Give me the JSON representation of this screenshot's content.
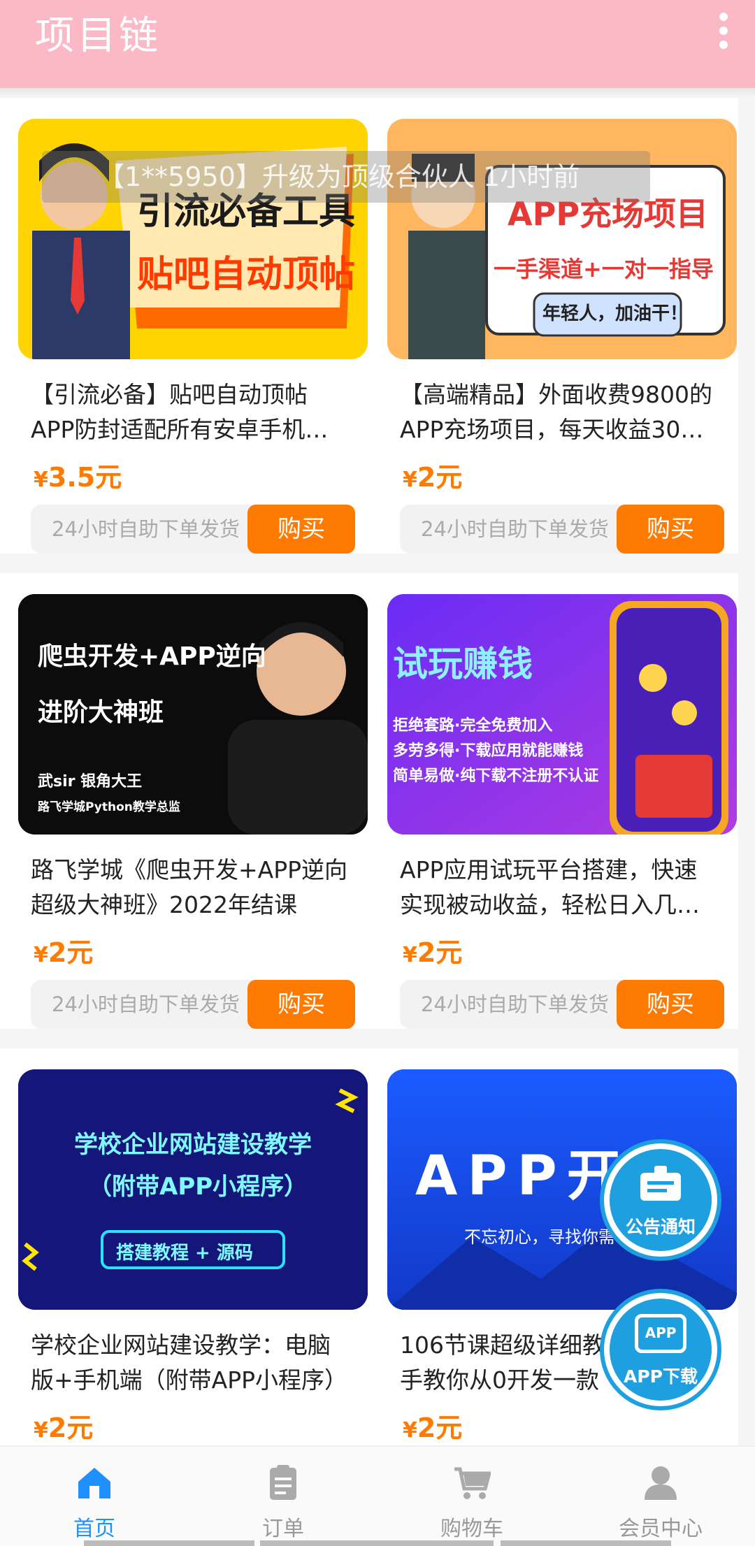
{
  "app": {
    "title": "项目链"
  },
  "ticker": "【1**5950】升级为顶级合伙人 1小时前",
  "products": [
    {
      "title_line1": "【引流必备】贴吧自动顶帖",
      "title_line2": "APP防封适配所有安卓手机…",
      "price_symbol": "¥",
      "price": "3.5元",
      "delivery": "24小时自助下单发货",
      "buy": "购买",
      "thumb": {
        "line1": "引流必备工具",
        "line2": "贴吧自动顶帖"
      }
    },
    {
      "title_line1": "【高端精品】外面收费9800的",
      "title_line2": "APP充场项目，每天收益30…",
      "price_symbol": "¥",
      "price": "2元",
      "delivery": "24小时自助下单发货",
      "buy": "购买",
      "thumb": {
        "line1": "APP充场项目",
        "line2": "一手渠道+一对一指导",
        "line3": "年轻人，加油干！"
      }
    },
    {
      "title_line1": "路飞学城《爬虫开发+APP逆向",
      "title_line2": "超级大神班》2022年结课",
      "price_symbol": "¥",
      "price": "2元",
      "delivery": "24小时自助下单发货",
      "buy": "购买",
      "thumb": {
        "line1": "爬虫开发+APP逆向",
        "line2": "进阶大神班",
        "line3": "武sir 银角大王",
        "line4": "路飞学城Python教学总监"
      }
    },
    {
      "title_line1": "APP应用试玩平台搭建，快速",
      "title_line2": "实现被动收益，轻松日入几…",
      "price_symbol": "¥",
      "price": "2元",
      "delivery": "24小时自助下单发货",
      "buy": "购买",
      "thumb": {
        "line1": "试玩赚钱",
        "line2": "拒绝套路·完全免费加入",
        "line3": "多劳多得·下载应用就能赚钱",
        "line4": "简单易做·纯下载不注册不认证"
      }
    },
    {
      "title_line1": "学校企业网站建设教学：电脑",
      "title_line2": "版+手机端（附带APP小程序）",
      "price_symbol": "¥",
      "price": "2元",
      "thumb": {
        "line1": "学校企业网站建设教学",
        "line2": "（附带APP小程序）",
        "line3": "搭建教程 + 源码"
      }
    },
    {
      "title_line1": "106节课超级详细教程",
      "title_line2": "手教你从0开发一款",
      "price_symbol": "¥",
      "price": "2元",
      "thumb": {
        "line1": "APP开发",
        "line2": "不忘初心，寻找你需"
      }
    }
  ],
  "fabs": {
    "notice": "公告通知",
    "download": "APP下载",
    "download_icon": "APP"
  },
  "tabs": [
    {
      "label": "首页",
      "icon": "home-icon"
    },
    {
      "label": "订单",
      "icon": "clipboard-icon"
    },
    {
      "label": "购物车",
      "icon": "cart-icon"
    },
    {
      "label": "会员中心",
      "icon": "user-icon"
    }
  ],
  "colors": {
    "accent": "#ff7a00",
    "header": "#fbb9c5",
    "tab_active": "#1e90ff"
  }
}
